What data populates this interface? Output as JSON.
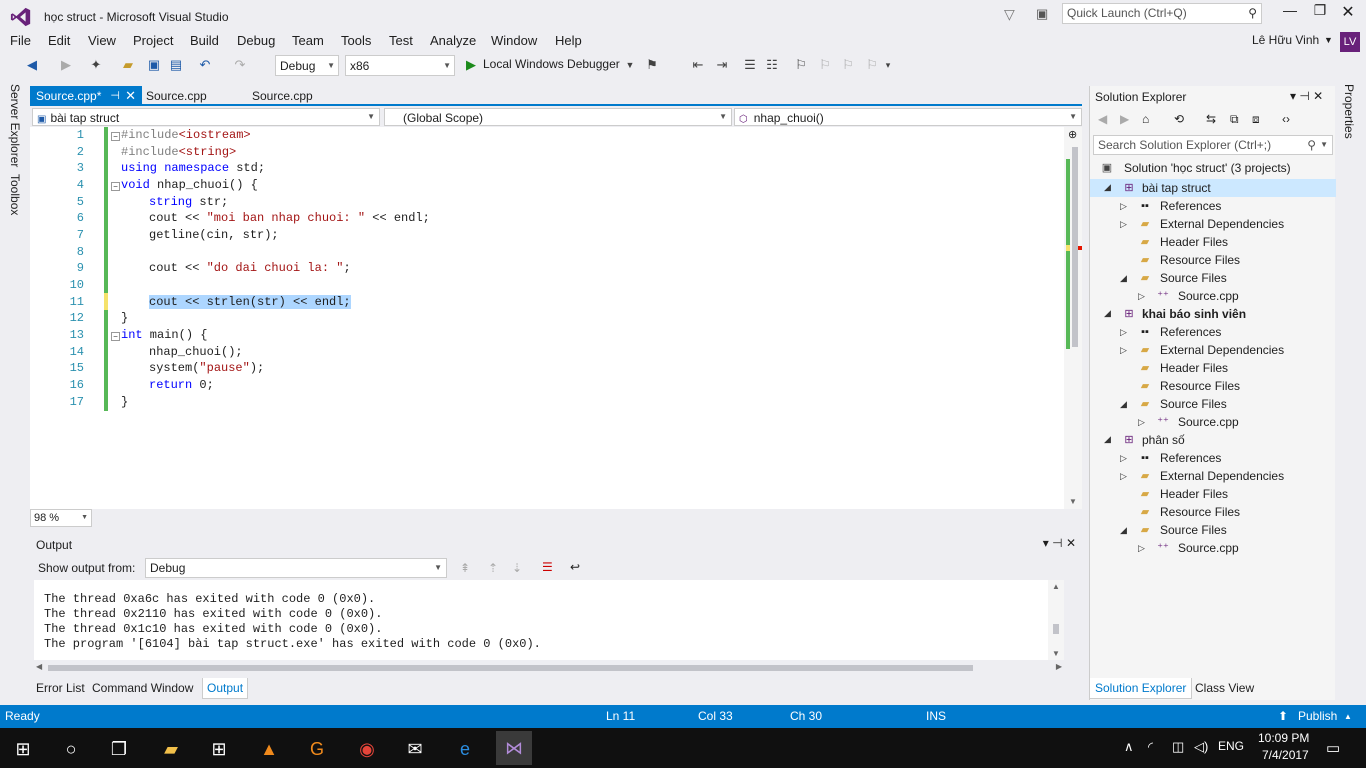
{
  "window": {
    "title": "học  struct - Microsoft Visual Studio",
    "quick_launch_placeholder": "Quick Launch (Ctrl+Q)"
  },
  "menu": [
    "File",
    "Edit",
    "View",
    "Project",
    "Build",
    "Debug",
    "Team",
    "Tools",
    "Test",
    "Analyze",
    "Window",
    "Help"
  ],
  "user": {
    "name": "Lê Hữu Vinh",
    "initials": "LV"
  },
  "toolbar": {
    "config": "Debug",
    "platform": "x86",
    "debugger": "Local Windows Debugger"
  },
  "side_tabs": {
    "server_explorer": "Server Explorer",
    "toolbox": "Toolbox",
    "properties": "Properties"
  },
  "doc_tabs": [
    "Source.cpp*",
    "Source.cpp",
    "Source.cpp"
  ],
  "navbar": {
    "project": "bài tap struct",
    "scope": "(Global Scope)",
    "member": "nhap_chuoi()"
  },
  "code_lines": [
    {
      "n": "1"
    },
    {
      "n": "2"
    },
    {
      "n": "3"
    },
    {
      "n": "4"
    },
    {
      "n": "5"
    },
    {
      "n": "6"
    },
    {
      "n": "7"
    },
    {
      "n": "8"
    },
    {
      "n": "9"
    },
    {
      "n": "10"
    },
    {
      "n": "11"
    },
    {
      "n": "12"
    },
    {
      "n": "13"
    },
    {
      "n": "14"
    },
    {
      "n": "15"
    },
    {
      "n": "16"
    },
    {
      "n": "17"
    }
  ],
  "code": {
    "l1a": "#include",
    "l1b": "<iostream>",
    "l2a": "#include",
    "l2b": "<string>",
    "l3a": "using",
    "l3b": " ",
    "l3c": "namespace",
    "l3d": " std;",
    "l4a": "void",
    "l4b": " nhap_chuoi() {",
    "l5a": "string",
    "l5b": " str;",
    "l6a": "cout << ",
    "l6b": "\"moi ban nhap chuoi: \"",
    "l6c": " << endl;",
    "l7": "getline(cin, str);",
    "l9a": "cout << ",
    "l9b": "\"do dai chuoi la: \"",
    "l9c": ";",
    "l11": "cout << strlen(str) << endl;",
    "l12": "}",
    "l13a": "int",
    "l13b": " main() {",
    "l14": "nhap_chuoi();",
    "l15a": "system(",
    "l15b": "\"pause\"",
    "l15c": ");",
    "l16a": "return",
    "l16b": " 0;",
    "l17": "}"
  },
  "zoom": "98 %",
  "output": {
    "title": "Output",
    "show_from_label": "Show output from:",
    "source": "Debug",
    "lines": [
      "The thread 0xa6c has exited with code 0 (0x0).",
      "The thread 0x2110 has exited with code 0 (0x0).",
      "The thread 0x1c10 has exited with code 0 (0x0).",
      "The program '[6104] bài tap struct.exe' has exited with code 0 (0x0)."
    ]
  },
  "bottom_tabs": [
    "Error List",
    "Command Window",
    "Output"
  ],
  "solution_explorer": {
    "title": "Solution Explorer",
    "search_placeholder": "Search Solution Explorer (Ctrl+;)",
    "solution": "Solution 'học  struct' (3 projects)",
    "projects": [
      {
        "name": "bài tap struct",
        "children": [
          "References",
          "External Dependencies",
          "Header Files",
          "Resource Files",
          "Source Files"
        ],
        "file": "Source.cpp"
      },
      {
        "name": "khai báo sinh viên",
        "children": [
          "References",
          "External Dependencies",
          "Header Files",
          "Resource Files",
          "Source Files"
        ],
        "file": "Source.cpp"
      },
      {
        "name": "phân số",
        "children": [
          "References",
          "External Dependencies",
          "Header Files",
          "Resource Files",
          "Source Files"
        ],
        "file": "Source.cpp"
      }
    ],
    "tabs": [
      "Solution Explorer",
      "Class View"
    ]
  },
  "status": {
    "state": "Ready",
    "ln": "Ln 11",
    "col": "Col 33",
    "ch": "Ch 30",
    "mode": "INS",
    "publish": "Publish"
  },
  "taskbar": {
    "lang": "ENG",
    "time": "10:09 PM",
    "date": "7/4/2017"
  },
  "colors": {
    "accent": "#007acc",
    "vs_purple": "#68217a",
    "keyword": "#0000ff",
    "string": "#a31515",
    "linenum": "#2b91af"
  }
}
